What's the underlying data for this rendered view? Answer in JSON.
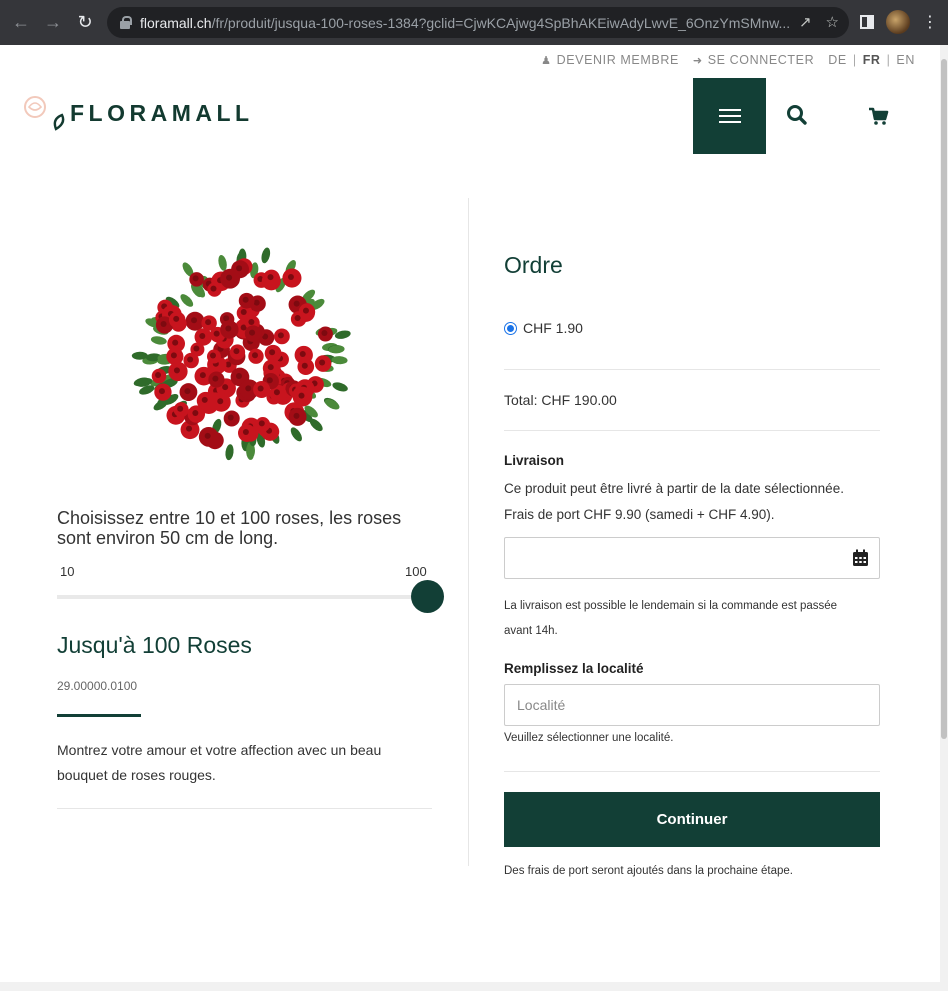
{
  "browser": {
    "url_domain": "floramall.ch",
    "url_path": "/fr/produit/jusqua-100-roses-1384?gclid=CjwKCAjwg4SpBhAKEiwAdyLwvE_6OnzYmSMnw..."
  },
  "topbar": {
    "member": "DEVENIR MEMBRE",
    "login": "SE CONNECTER",
    "languages": {
      "de": "DE",
      "fr": "FR",
      "en": "EN",
      "sep": "|"
    }
  },
  "logo": {
    "text": "FLORAMALL"
  },
  "product": {
    "choose_text": "Choisissez entre 10 et 100 roses, les roses sont environ 50 cm de long.",
    "slider": {
      "min_label": "10",
      "max_label": "100",
      "min": 10,
      "max": 100,
      "value": 100
    },
    "title": "Jusqu'à 100 Roses",
    "sku": "29.00000.0100",
    "description": "Montrez votre amour et votre affection avec un beau bouquet de roses rouges."
  },
  "order": {
    "title": "Ordre",
    "price_option": "CHF 1.90",
    "total": "Total: CHF 190.00",
    "delivery": {
      "heading": "Livraison",
      "line1": "Ce produit peut être livré à partir de la date sélectionnée.",
      "line2": "Frais de port CHF 9.90 (samedi + CHF 4.90).",
      "note_line1": "La livraison est possible le lendemain si la commande est passée",
      "note_line2": "avant 14h."
    },
    "locality": {
      "heading": "Remplissez la localité",
      "placeholder": "Localité",
      "hint": "Veuillez sélectionner une localité."
    },
    "continue_label": "Continuer",
    "footer_note": "Des frais de port seront ajoutés dans la prochaine étape."
  },
  "colors": {
    "brand": "#123f36",
    "radio": "#1a73e8",
    "rose": "#c8141e"
  }
}
